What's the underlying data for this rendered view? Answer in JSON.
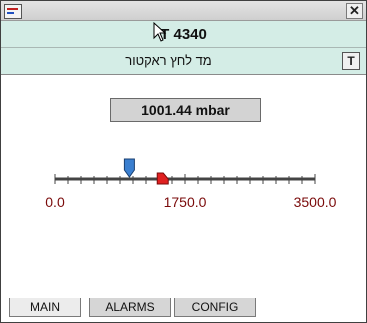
{
  "window": {
    "app_icon": "app-window-icon",
    "close_label": "✕"
  },
  "header": {
    "tag_title": "T 4340",
    "description": "מד לחץ ראקטור",
    "t_button_label": "T"
  },
  "reading": {
    "value_text": "1001.44 mbar",
    "value": 1001.44,
    "unit": "mbar"
  },
  "scale": {
    "min": 0.0,
    "max": 3500.0,
    "tick_labels": [
      "0.0",
      "1750.0",
      "3500.0"
    ],
    "pointer_value": 1001.44,
    "setpoint_value": 1430,
    "pointer_color": "#3a7fd0",
    "setpoint_color": "#e02020"
  },
  "tabs": [
    {
      "label": "MAIN",
      "active": true
    },
    {
      "label": "ALARMS",
      "active": false
    },
    {
      "label": "CONFIG",
      "active": false
    }
  ]
}
